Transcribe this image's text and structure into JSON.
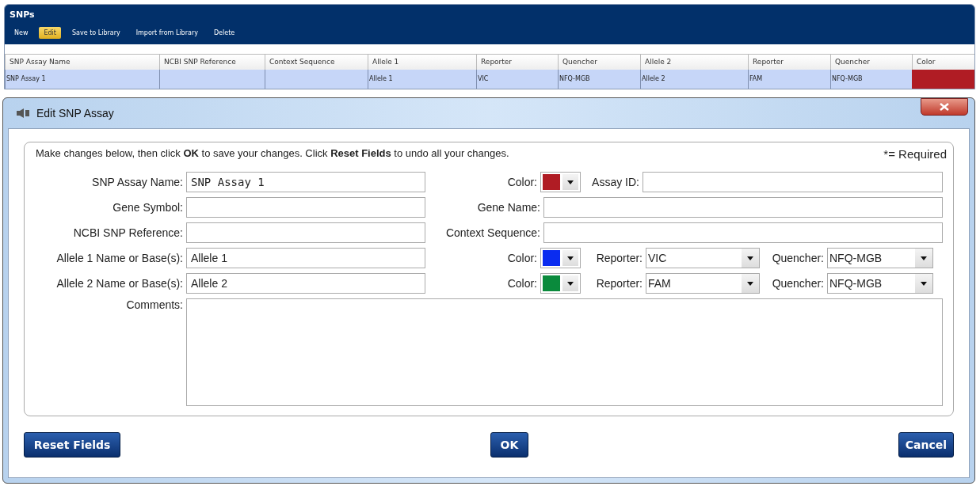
{
  "panel": {
    "title": "SNPs"
  },
  "toolbar": [
    {
      "label": "New",
      "selected": false
    },
    {
      "label": "Edit",
      "selected": true
    },
    {
      "label": "Save to Library",
      "selected": false
    },
    {
      "label": "Import from Library",
      "selected": false
    },
    {
      "label": "Delete",
      "selected": false
    }
  ],
  "table": {
    "columns": [
      "SNP Assay Name",
      "NCBI SNP Reference",
      "Context Sequence",
      "Allele 1",
      "Reporter",
      "Quencher",
      "Allele 2",
      "Reporter",
      "Quencher",
      "Color"
    ],
    "rows": [
      {
        "selected": true,
        "cells": [
          "SNP Assay 1",
          "",
          "",
          "Allele 1",
          "VIC",
          "NFQ-MGB",
          "Allele 2",
          "FAM",
          "NFQ-MGB"
        ],
        "color": "#b01c24"
      }
    ]
  },
  "dialog": {
    "title": "Edit SNP Assay",
    "instruction": "Make changes below, then click **OK** to save your changes. Click **Reset Fields** to undo all your changes.",
    "required_note": "*= Required",
    "rows": [
      {
        "label": "SNP Assay Name:",
        "value": "SNP Assay 1",
        "right": {
          "kind": "color-id",
          "label": "Color:",
          "color": "#b01c24",
          "id_label": "Assay ID:"
        }
      },
      {
        "label": "Gene Symbol:",
        "right": {
          "kind": "text",
          "label": "Gene Name:"
        }
      },
      {
        "label": "NCBI SNP Reference:",
        "right": {
          "kind": "text",
          "label": "Context Sequence:"
        }
      },
      {
        "label": "Allele 1 Name or Base(s):",
        "value": "Allele 1",
        "right": {
          "kind": "dyes",
          "label": "Color:",
          "color": "#0a2cf0",
          "reporter_label": "Reporter:",
          "reporter": "VIC",
          "quencher_label": "Quencher:",
          "quencher": "NFQ-MGB"
        }
      },
      {
        "label": "Allele 2 Name or Base(s):",
        "value": "Allele 2",
        "right": {
          "kind": "dyes",
          "label": "Color:",
          "color": "#0a8a3c",
          "reporter_label": "Reporter:",
          "reporter": "FAM",
          "quencher_label": "Quencher:",
          "quencher": "NFQ-MGB"
        }
      }
    ],
    "comments_label": "Comments:",
    "buttons": [
      {
        "label": "Reset Fields",
        "kind": "left"
      },
      {
        "label": "OK",
        "kind": "center"
      },
      {
        "label": "Cancel",
        "kind": "right"
      }
    ]
  }
}
